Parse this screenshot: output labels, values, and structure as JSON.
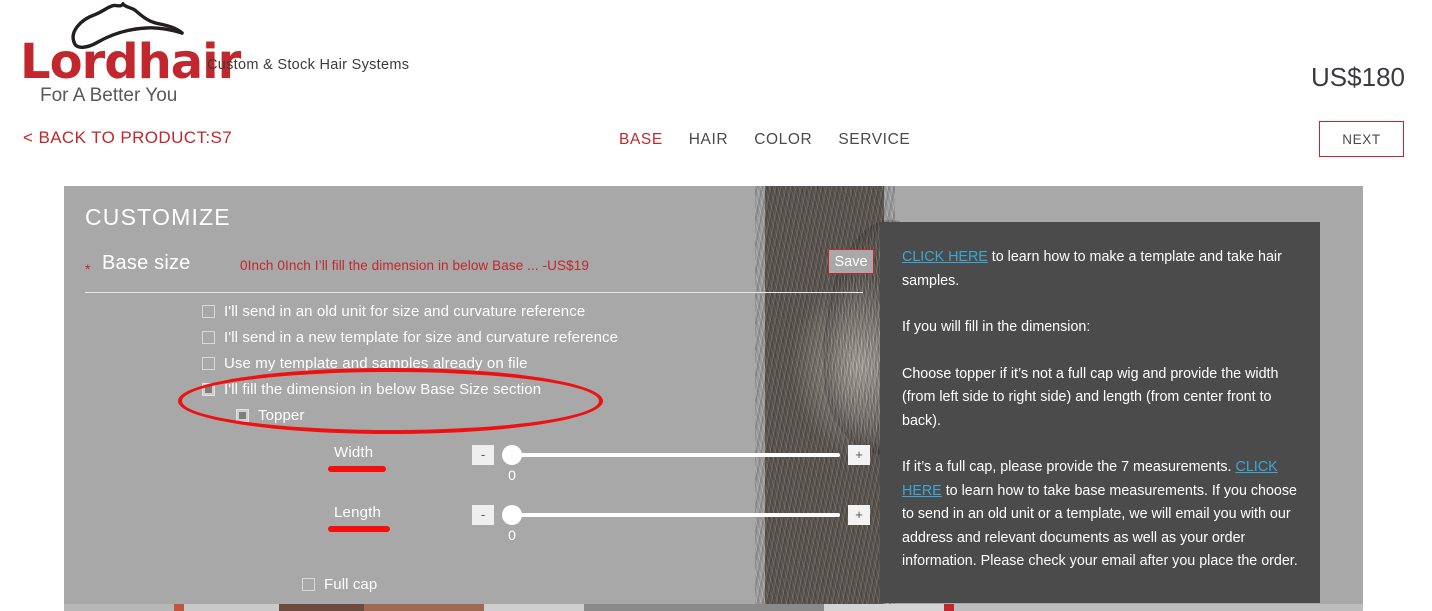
{
  "brand": {
    "name": "Lordhair",
    "slogan": "For A Better You",
    "tagline": "Custom & Stock Hair Systems",
    "accent_color": "#c1272d"
  },
  "header": {
    "price": "US$180"
  },
  "nav": {
    "back_label": "< BACK TO PRODUCT:S7",
    "steps": [
      {
        "label": "BASE",
        "active": true
      },
      {
        "label": "HAIR",
        "active": false
      },
      {
        "label": "COLOR",
        "active": false
      },
      {
        "label": "SERVICE",
        "active": false
      }
    ],
    "next_label": "NEXT"
  },
  "panel": {
    "title": "CUSTOMIZE",
    "section": {
      "required_marker": "*",
      "name": "Base size",
      "summary": "0Inch 0Inch I’ll fill the dimension in below Base ... -US$19",
      "save_label": "Save"
    },
    "options": [
      {
        "label": "I'll send in an old unit for size and curvature reference",
        "checked": false,
        "indent": false
      },
      {
        "label": "I'll send in a new template for size and curvature reference",
        "checked": false,
        "indent": false
      },
      {
        "label": "Use my template and samples already on file",
        "checked": false,
        "indent": false
      },
      {
        "label": "I'll fill the dimension in below Base Size section",
        "checked": true,
        "indent": false
      },
      {
        "label": "Topper",
        "checked": true,
        "indent": true
      }
    ],
    "sliders": [
      {
        "label": "Width",
        "value": "0",
        "minus": "-",
        "plus": "+"
      },
      {
        "label": "Length",
        "value": "0",
        "minus": "-",
        "plus": "+"
      }
    ],
    "full_cap": {
      "label": "Full cap",
      "checked": false
    }
  },
  "info": {
    "p1_link": "CLICK HERE",
    "p1_rest": " to learn how to make a template and take hair samples.",
    "p2": "If you will fill in the dimension:",
    "p3": "Choose topper if it’s not a full cap wig and provide the width (from left side to right side) and length (from center front to back).",
    "p4_a": "If it’s a full cap, please provide the 7 measurements. ",
    "p4_link": "CLICK HERE",
    "p4_rest": " to learn how to take base measurements. If you choose to send in an old unit or a template, we will email you with our address and relevant documents as well as your order information. Please check your email after you place the order.",
    "link_color": "#3aa8d8"
  },
  "annotations": {
    "ellipse_target": "I'll fill the dimension / Topper options",
    "underline_1": "Width",
    "underline_2": "Length",
    "color": "#ee1111"
  }
}
